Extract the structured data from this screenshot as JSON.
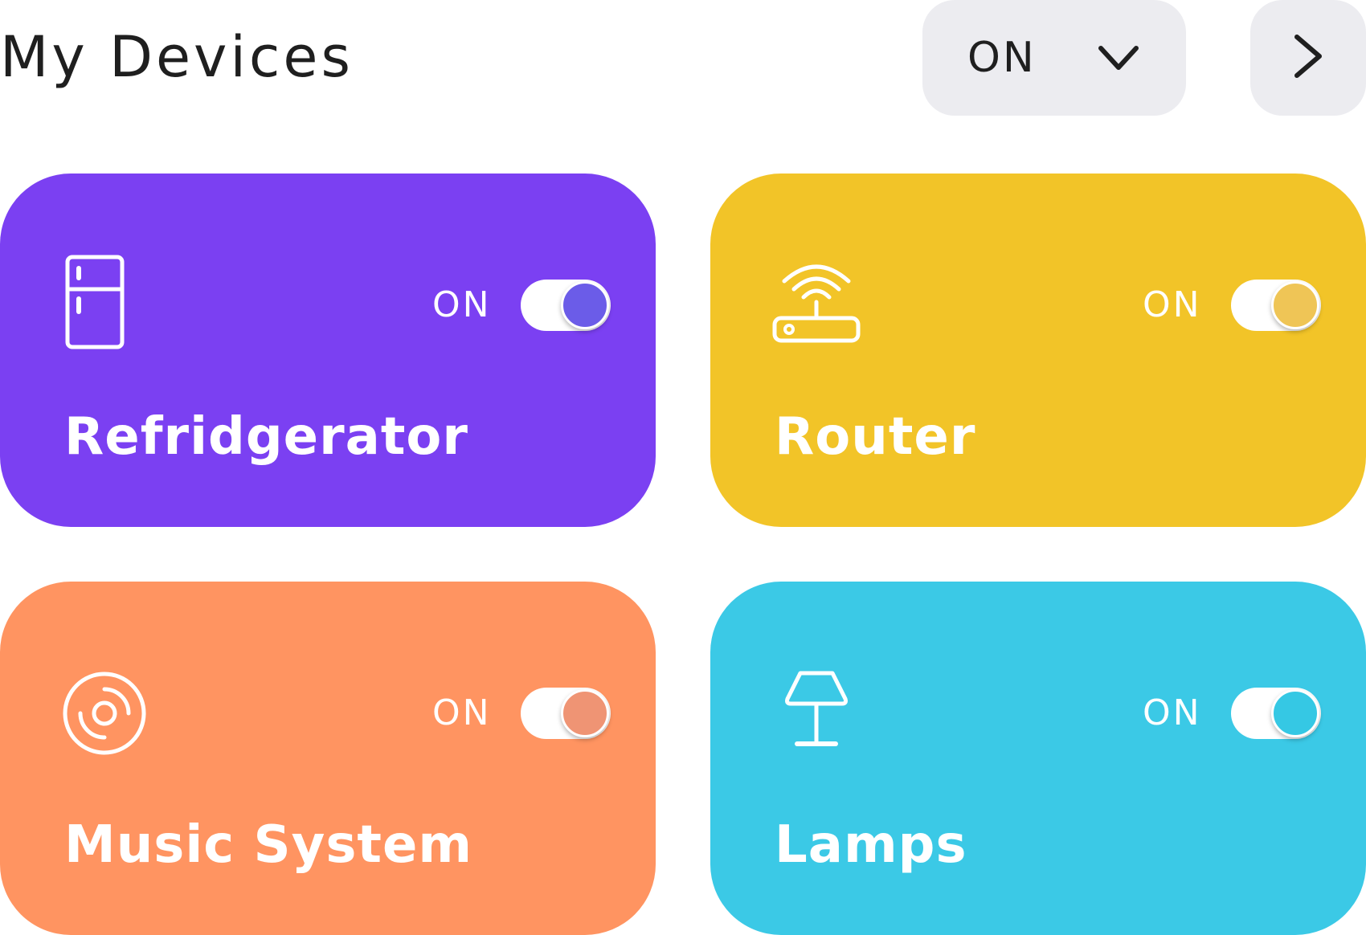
{
  "header": {
    "title": "My Devices",
    "filter_value": "ON",
    "filter_icon": "chevron-down-icon",
    "next_icon": "chevron-right-icon"
  },
  "devices": [
    {
      "name": "Refridgerator",
      "status": "ON",
      "icon": "refrigerator-icon",
      "color": "#7b40f2",
      "knob_color": "#6b5ce8"
    },
    {
      "name": "Router",
      "status": "ON",
      "icon": "router-icon",
      "color": "#f2c428",
      "knob_color": "#efc556"
    },
    {
      "name": "Music System",
      "status": "ON",
      "icon": "music-disc-icon",
      "color": "#ff9461",
      "knob_color": "#ef9474"
    },
    {
      "name": "Lamps",
      "status": "ON",
      "icon": "lamp-icon",
      "color": "#3bc9e6",
      "knob_color": "#35c8e4"
    }
  ]
}
